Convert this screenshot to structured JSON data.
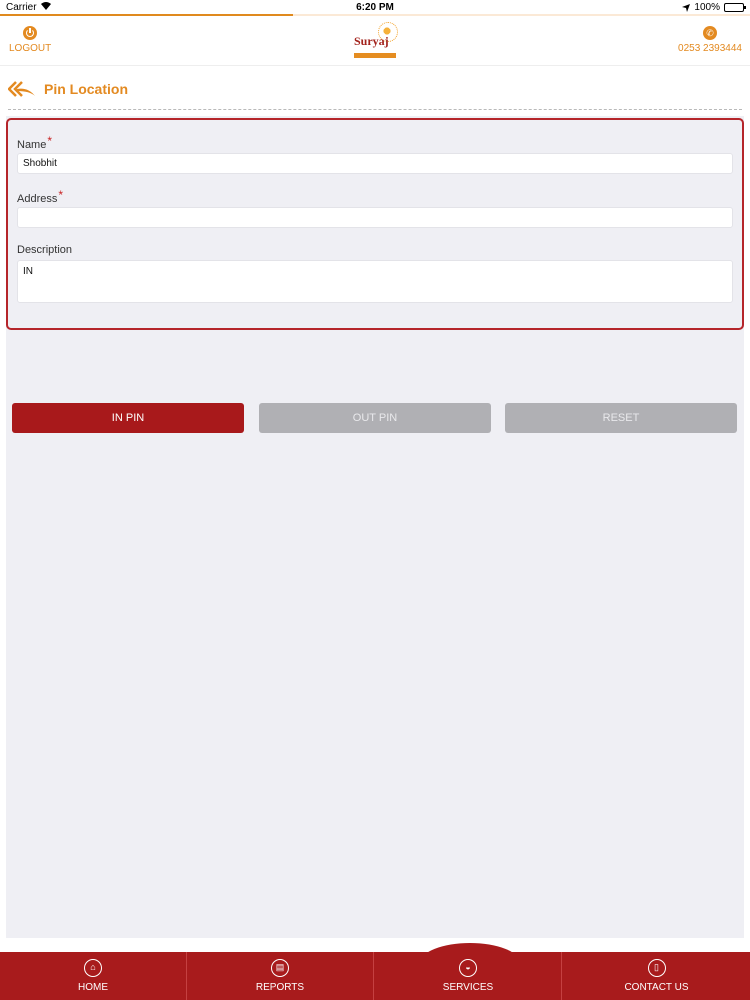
{
  "status": {
    "carrier": "Carrier",
    "time": "6:20 PM",
    "battery": "100%"
  },
  "header": {
    "logout_label": "LOGOUT",
    "logo_text": "Suryaj",
    "phone": "0253 2393444"
  },
  "page": {
    "title": "Pin Location"
  },
  "form": {
    "name_label": "Name",
    "name_value": "Shobhit",
    "address_label": "Address",
    "address_value": "",
    "description_label": "Description",
    "description_value": "IN",
    "required_mark": "*"
  },
  "buttons": {
    "in_pin": "IN PIN",
    "out_pin": "OUT PIN",
    "reset": "RESET"
  },
  "nav": {
    "items": [
      {
        "label": "HOME",
        "icon": "home-icon"
      },
      {
        "label": "REPORTS",
        "icon": "reports-icon"
      },
      {
        "label": "SERVICES",
        "icon": "services-icon"
      },
      {
        "label": "CONTACT US",
        "icon": "contact-icon"
      }
    ]
  },
  "colors": {
    "accent": "#e38a21",
    "brand_red": "#a81b1c",
    "background": "#efeff4"
  }
}
